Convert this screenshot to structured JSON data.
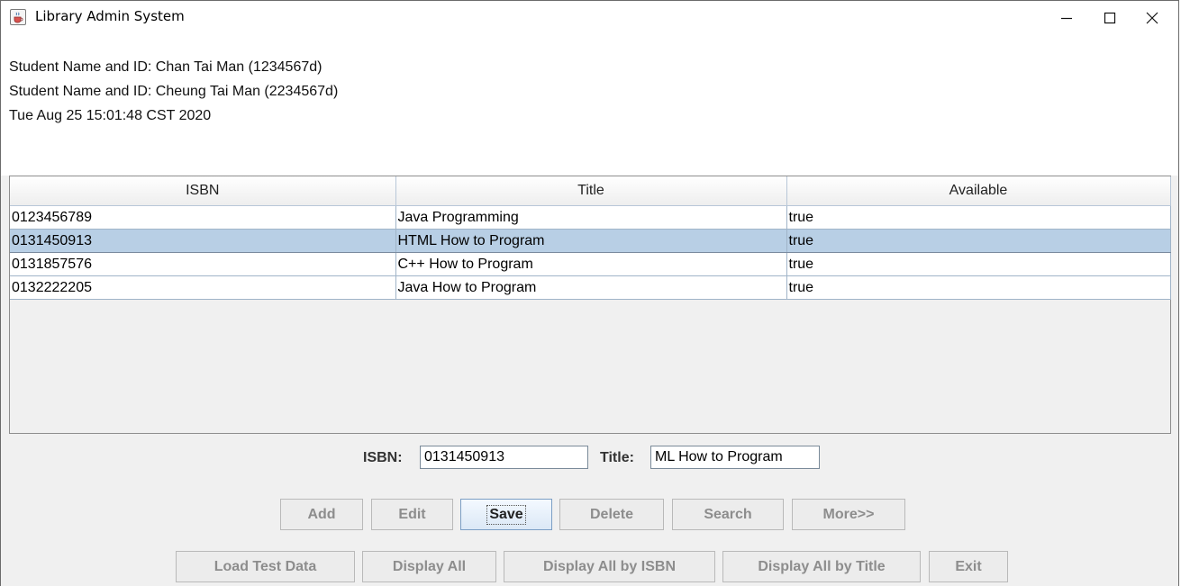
{
  "window": {
    "title": "Library Admin System",
    "minimize_label": "—",
    "maximize_label": "☐",
    "close_label": "✕",
    "icon": "java-cup-icon"
  },
  "header": {
    "lines": [
      "Student Name and ID: Chan Tai Man (1234567d)",
      "Student Name and ID: Cheung Tai Man (2234567d)",
      "Tue Aug 25 15:01:48 CST 2020"
    ]
  },
  "table": {
    "columns": [
      "ISBN",
      "Title",
      "Available"
    ],
    "rows": [
      [
        "0123456789",
        "Java Programming",
        "true"
      ],
      [
        "0131450913",
        "HTML How to Program",
        "true"
      ],
      [
        "0131857576",
        "C++ How to Program",
        "true"
      ],
      [
        "0132222205",
        "Java How to Program",
        "true"
      ]
    ],
    "selected_row": 1
  },
  "form": {
    "isbn_label": "ISBN:",
    "isbn_value": "0131450913",
    "title_label": "Title:",
    "title_value": "ML How to Program"
  },
  "buttons_row1": {
    "add": "Add",
    "edit": "Edit",
    "save": "Save",
    "delete": "Delete",
    "search": "Search",
    "more": "More>>"
  },
  "buttons_row2": {
    "load_test_data": "Load Test Data",
    "display_all": "Display All",
    "display_all_by_isbn": "Display All by ISBN",
    "display_all_by_title": "Display All by Title",
    "exit": "Exit"
  },
  "colors": {
    "selection": "#b8cfe5",
    "window_bg": "#f0f0f0",
    "disabled_text": "#8d8d8d"
  }
}
